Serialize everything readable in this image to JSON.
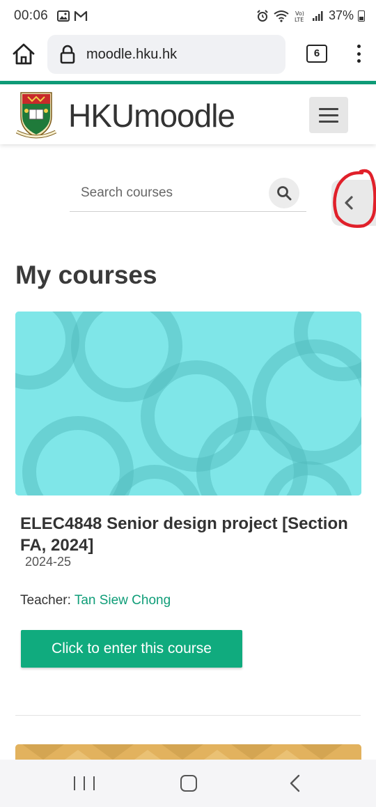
{
  "status_bar": {
    "time": "00:06",
    "battery": "37%",
    "icons": [
      "gallery-icon",
      "gmail-icon",
      "alarm-icon",
      "wifi-icon",
      "volte-icon",
      "signal-icon",
      "battery-icon"
    ]
  },
  "browser": {
    "url": "moodle.hku.hk",
    "tab_count": "6"
  },
  "header": {
    "brand_bold": "HKU",
    "brand_rest": "moodle"
  },
  "search": {
    "placeholder": "Search courses"
  },
  "main": {
    "title": "My courses",
    "courses": [
      {
        "name": "ELEC4848 Senior design project [Section FA, 2024]",
        "year": "2024-25",
        "teacher_label": "Teacher: ",
        "teacher_name": "Tan Siew Chong",
        "enter_label": "Click to enter this course"
      }
    ]
  },
  "colors": {
    "accent": "#0f9d78",
    "button": "#10ab7e",
    "card1": "#7fe6e8",
    "card2": "#e2b25e",
    "annotation": "#e0202a"
  }
}
